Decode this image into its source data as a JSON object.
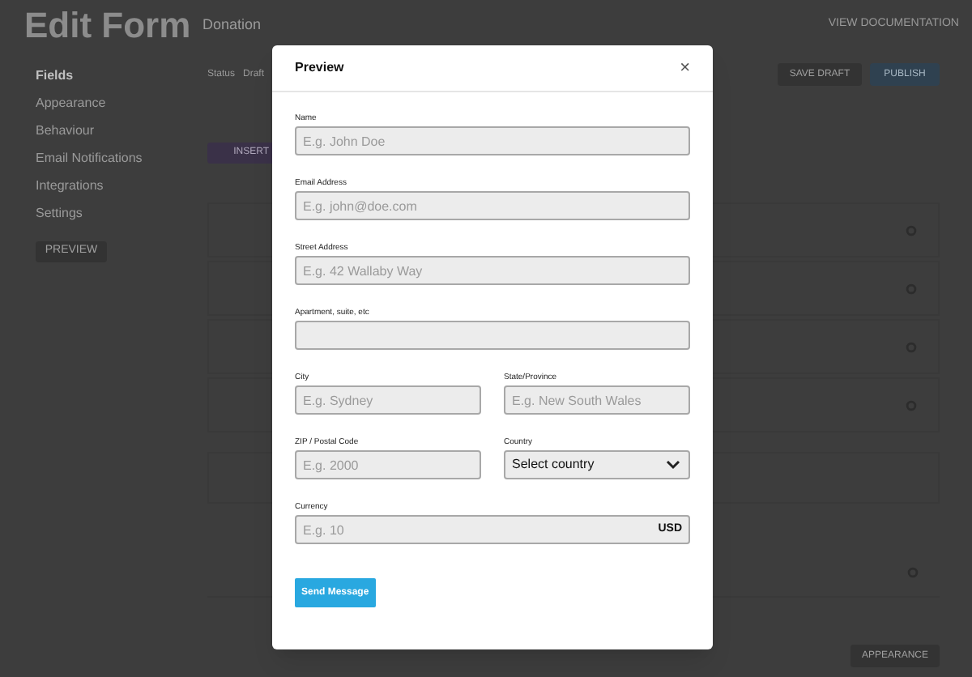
{
  "page": {
    "title": "Edit Form",
    "form_name": "Donation",
    "docs_link": "VIEW DOCUMENTATION",
    "sidebar": {
      "items": [
        {
          "label": "Fields",
          "selected": true
        },
        {
          "label": "Appearance",
          "selected": false
        },
        {
          "label": "Behaviour",
          "selected": false
        },
        {
          "label": "Email Notifications",
          "selected": false
        },
        {
          "label": "Integrations",
          "selected": false
        },
        {
          "label": "Settings",
          "selected": false
        }
      ]
    },
    "preview_button": "PREVIEW",
    "status_label": "Status",
    "status_value": "Draft",
    "save_draft_button": "SAVE DRAFT",
    "publish_button": "PUBLISH",
    "insert_button": "INSERT",
    "next_button": "APPEARANCE"
  },
  "modal": {
    "title": "Preview",
    "close": "×",
    "rows": [
      [
        {
          "kind": "text",
          "label": "Name",
          "placeholder": "E.g. John Doe"
        }
      ],
      [
        {
          "kind": "text",
          "label": "Email Address",
          "placeholder": "E.g. john@doe.com"
        }
      ],
      [
        {
          "kind": "text",
          "label": "Street Address",
          "placeholder": "E.g. 42 Wallaby Way"
        }
      ],
      [
        {
          "kind": "text",
          "label": "Apartment, suite, etc"
        }
      ],
      [
        {
          "kind": "text",
          "label": "City",
          "placeholder": "E.g. Sydney"
        },
        {
          "kind": "text",
          "label": "State/Province",
          "placeholder": "E.g. New South Wales"
        }
      ],
      [
        {
          "kind": "text",
          "label": "ZIP / Postal Code",
          "placeholder": "E.g. 2000"
        },
        {
          "kind": "select",
          "label": "Country",
          "value": "Select country"
        }
      ],
      [
        {
          "kind": "currency",
          "label": "Currency",
          "placeholder": "E.g. 10",
          "suffix": "USD"
        }
      ]
    ],
    "submit_button": "Send Message"
  }
}
